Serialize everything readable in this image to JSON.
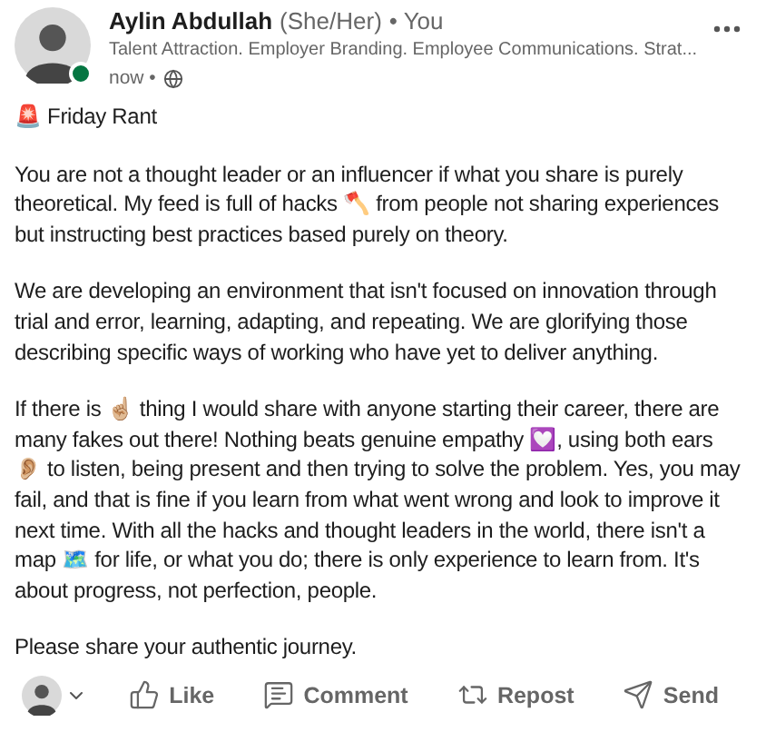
{
  "post": {
    "author": {
      "name": "Aylin Abdullah",
      "pronouns": "(She/Her)",
      "relation": "• You",
      "headline": "Talent Attraction. Employer Branding. Employee Communications. Strat...",
      "time": "now •",
      "online": true
    },
    "title": "🚨 Friday Rant",
    "paragraphs": [
      "You are not a thought leader or an influencer if what you share is purely theoretical. My feed is full of hacks 🪓 from people not sharing experiences but instructing best practices based purely on theory.",
      "We are developing an environment that isn't focused on innovation through trial and error, learning, adapting, and repeating. We are glorifying those describing specific ways of working who have yet to deliver anything.",
      "If there is ☝🏼 thing I would share with anyone starting their career, there are many fakes out there! Nothing beats genuine empathy 💟, using both ears 👂🏼 to listen, being present and then trying to solve the problem. Yes, you may fail, and that is fine if you learn from what went wrong and look to improve it next time. With all the hacks and thought leaders in the world, there isn't a map 🗺️ for life, or what you do; there is only experience to learn from. It's about progress, not perfection, people.",
      "Please share your authentic journey."
    ]
  },
  "actions": [
    {
      "kind": "like",
      "label": "Like"
    },
    {
      "kind": "comment",
      "label": "Comment"
    },
    {
      "kind": "repost",
      "label": "Repost"
    },
    {
      "kind": "send",
      "label": "Send"
    }
  ]
}
